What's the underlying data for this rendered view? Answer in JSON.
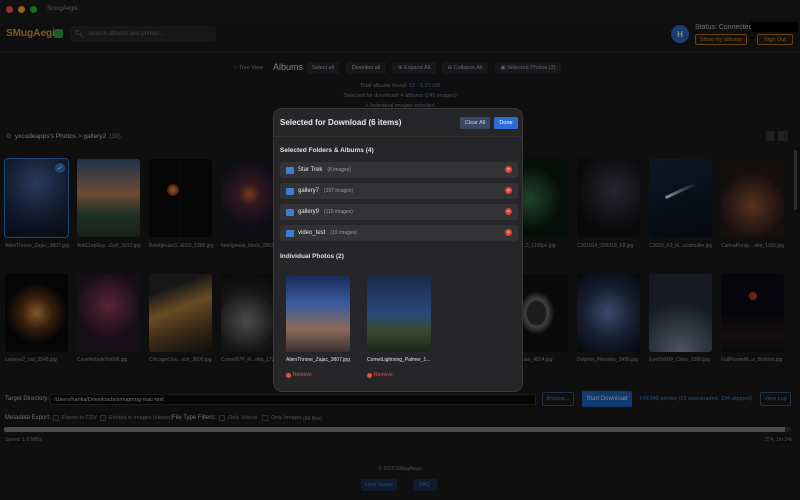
{
  "window": {
    "title": "SmugAegis"
  },
  "header": {
    "brand": "SMugAegis",
    "search_placeholder": "Search albums and photos...",
    "avatar_initial": "H",
    "status": "Status: Connected",
    "show_albums": "Show my albums",
    "sign_out": "Sign Out"
  },
  "toolbar": {
    "tree_view": "Tree View",
    "albums": "Albums",
    "select_all": "Select all",
    "deselect_all": "Deselect all",
    "expand_all": "Expand All",
    "collapse_all": "Collapse All",
    "selected_photos": "Selected Photos (2)"
  },
  "summary": {
    "total_label": "Total albums found:",
    "total_value": "12 · 1.21 GB",
    "selected_prefix": "Selected for download: 4 albums (",
    "selected_value": "245",
    "selected_suffix": " images)",
    "individual": "+ Individual images selected"
  },
  "breadcrumb": {
    "path": "yxcodeapps's Photos > gallery2",
    "count": "(39)"
  },
  "thumbnails": [
    {
      "caption": "AlienThrone_Zajac_3807.jpg"
    },
    {
      "caption": "AntiCrepRay...Goff_3072.jpg"
    },
    {
      "caption": "Betelgeuse3...ESO_1280.jpg"
    },
    {
      "caption": "betelgeuse_block_2663"
    },
    {
      "caption": "...th_20...3_1100px.jpg"
    },
    {
      "caption": "C201914_200318_F8.jpg"
    },
    {
      "caption": "C2020_F3_N...ucdmuller.jpg"
    },
    {
      "caption": "CarinaPersp....eim_1160.jpg"
    },
    {
      "caption": "catseye2_not_2048.jpg"
    },
    {
      "caption": "CaveNebulaHa608.jpg"
    },
    {
      "caption": "ChicagoClou...sch_3600.jpg"
    },
    {
      "caption": "Comet67P_R...etta_1724"
    },
    {
      "caption": "...nGal...ain_4824.jpg"
    },
    {
      "caption": "Dolphin_Pleiades_3495.jpg"
    },
    {
      "caption": "EyeOnMW_Claro_1080.jpg"
    },
    {
      "caption": "FullFlowerM...s_Boldrini.jpg"
    }
  ],
  "bottom": {
    "target_label": "Target Directory:",
    "target_path": "/Users/harika/Downloads/smugmug-mac-test",
    "browse": "Browse...",
    "start_download": "Start Download",
    "download_status": "149/349 photos (15 downloaded, 134 skipped)",
    "view_log": "View Log",
    "metadata_label": "Metadata Export:",
    "export_csv": "Export to CSV",
    "embed_images": "Embed in images (slower)",
    "filters_label": "File Type Filters:",
    "only_videos": "Only Videos",
    "only_images": "Only Images",
    "all_files": "(All files)",
    "progress": 0.993,
    "speed": "Speed: 1.6 MB/s",
    "eta": "274, 1m 34s",
    "copyright": "© 2025 SMugAegis",
    "user_guide": "User Guide",
    "faq": "FAQ"
  },
  "modal": {
    "title": "Selected for Download (6 items)",
    "clear_all": "Clear All",
    "done": "Done",
    "folders_title": "Selected Folders & Albums (4)",
    "folders": [
      {
        "name": "Star Trek",
        "count": "(8 images)"
      },
      {
        "name": "gallery7",
        "count": "(107 images)"
      },
      {
        "name": "gallery9",
        "count": "(115 images)"
      },
      {
        "name": "video_test",
        "count": "(19 images)"
      }
    ],
    "photos_title": "Individual Photos (2)",
    "photos": [
      {
        "name": "AlienThrone_Zajac_3807.jpg",
        "remove": "Remove"
      },
      {
        "name": "CometLightning_Palmer_1...",
        "remove": "Remove"
      }
    ]
  },
  "colors": {
    "accent": "#3d7fd6",
    "brand": "#e8a33c",
    "danger": "#d9453a"
  }
}
